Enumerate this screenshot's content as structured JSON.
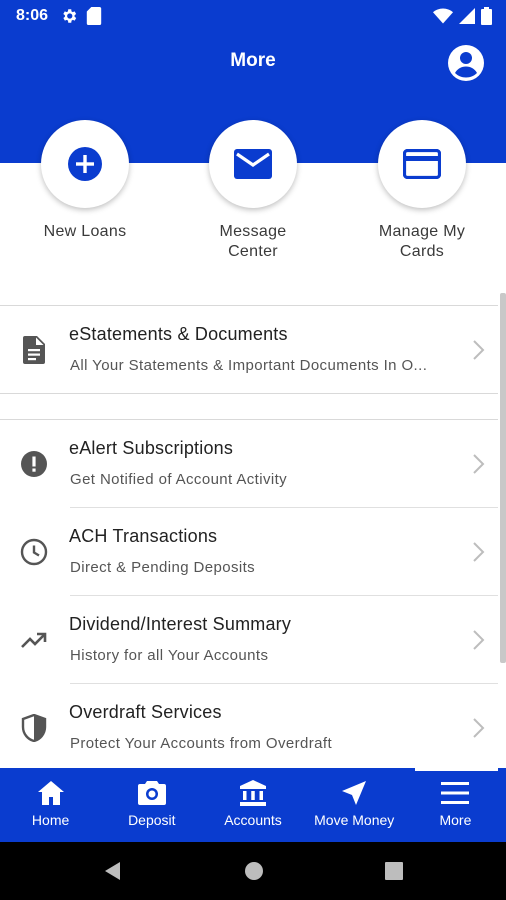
{
  "status_bar": {
    "time": "8:06",
    "left_icons": [
      "gear-icon",
      "sd-card-icon"
    ],
    "right_icons": [
      "wifi-icon",
      "signal-icon",
      "battery-icon"
    ]
  },
  "header": {
    "title": "More",
    "profile_icon": "account-circle-icon"
  },
  "quick_actions": [
    {
      "label": "New Loans",
      "icon": "plus-circle-icon"
    },
    {
      "label": "Message\nCenter",
      "icon": "mail-icon"
    },
    {
      "label": "Manage My\nCards",
      "icon": "credit-card-icon"
    }
  ],
  "list_items": [
    {
      "title": "eStatements & Documents",
      "subtitle": "All Your Statements & Important Documents In O...",
      "icon": "document-icon"
    },
    {
      "title": "eAlert Subscriptions",
      "subtitle": "Get Notified of Account Activity",
      "icon": "alert-icon"
    },
    {
      "title": "ACH Transactions",
      "subtitle": "Direct & Pending Deposits",
      "icon": "clock-icon"
    },
    {
      "title": "Dividend/Interest Summary",
      "subtitle": "History for all Your Accounts",
      "icon": "trending-up-icon"
    },
    {
      "title": "Overdraft Services",
      "subtitle": "Protect Your Accounts from Overdraft",
      "icon": "shield-icon"
    }
  ],
  "bottom_nav": {
    "items": [
      {
        "label": "Home",
        "icon": "home-icon"
      },
      {
        "label": "Deposit",
        "icon": "camera-icon"
      },
      {
        "label": "Accounts",
        "icon": "bank-icon"
      },
      {
        "label": "Move Money",
        "icon": "navigation-arrow-icon"
      },
      {
        "label": "More",
        "icon": "menu-icon"
      }
    ],
    "active": "More"
  },
  "colors": {
    "primary": "#0a3ccf",
    "icon_gray": "#555555"
  }
}
